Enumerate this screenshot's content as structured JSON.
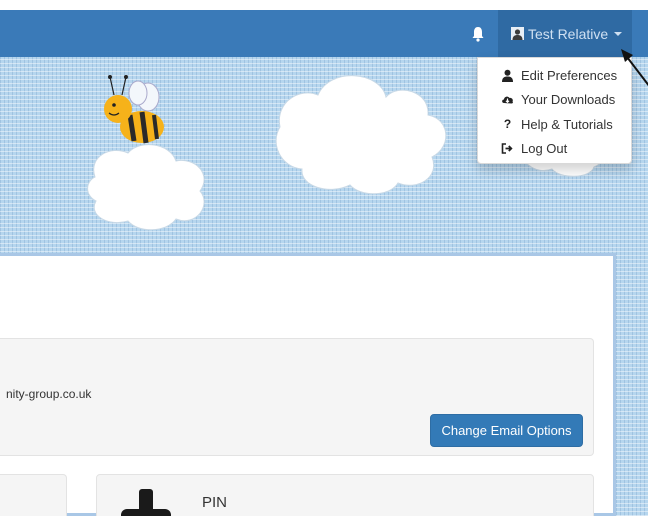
{
  "navbar": {
    "user_name": "Test Relative",
    "accent": "#3a7ab8",
    "user_menu_bg": "#2f6aa3"
  },
  "user_menu": {
    "items": [
      {
        "label": "Edit Preferences",
        "icon": "user-icon"
      },
      {
        "label": "Your Downloads",
        "icon": "cloud-download-icon"
      },
      {
        "label": "Help & Tutorials",
        "icon": "question-icon"
      },
      {
        "label": "Log Out",
        "icon": "log-out-icon"
      }
    ]
  },
  "email_section": {
    "address_fragment": "nity-group.co.uk",
    "button_label": "Change Email Options"
  },
  "pin_section": {
    "label": "PIN"
  }
}
